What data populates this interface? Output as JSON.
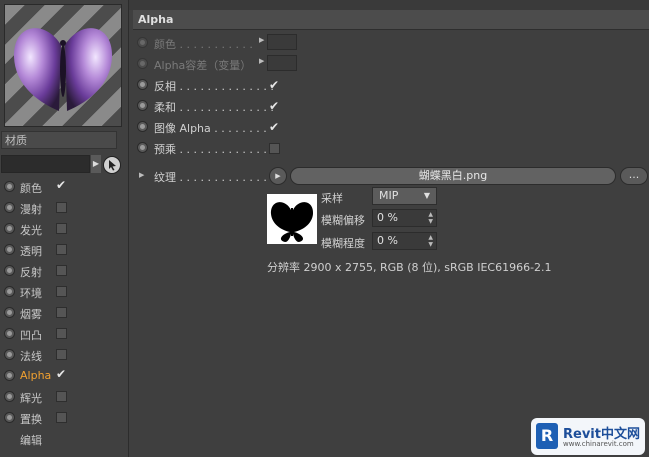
{
  "left_panel": {
    "material_label": "材质",
    "channels": [
      {
        "label": "颜色",
        "checked": true,
        "active": false
      },
      {
        "label": "漫射",
        "checked": false,
        "active": false
      },
      {
        "label": "发光",
        "checked": false,
        "active": false
      },
      {
        "label": "透明",
        "checked": false,
        "active": false
      },
      {
        "label": "反射",
        "checked": false,
        "active": false
      },
      {
        "label": "环境",
        "checked": false,
        "active": false
      },
      {
        "label": "烟雾",
        "checked": false,
        "active": false
      },
      {
        "label": "凹凸",
        "checked": false,
        "active": false
      },
      {
        "label": "法线",
        "checked": false,
        "active": false
      },
      {
        "label": "Alpha",
        "checked": true,
        "active": true
      },
      {
        "label": "辉光",
        "checked": false,
        "active": false
      },
      {
        "label": "置换",
        "checked": false,
        "active": false
      },
      {
        "label": "编辑",
        "checked": null,
        "active": false
      }
    ]
  },
  "alpha_panel": {
    "title": "Alpha",
    "color_label": "颜色 . . . . . . . . . . .",
    "tolerance_label": "Alpha容差（变量）",
    "invert_label": "反相 . . . . . . . . . . . . . .",
    "soft_label": "柔和 . . . . . . . . . . . . . .",
    "image_alpha_label": "图像 Alpha . . . . . . . .",
    "premult_label": "预乘 . . . . . . . . . . . . . .",
    "invert_checked": true,
    "soft_checked": true,
    "image_alpha_checked": true,
    "premult_checked": false,
    "texture_label": "纹理 . . . . . . . . . . . . . . .",
    "texture_file": "蝴蝶黑白.png",
    "more_button": "...",
    "sampling_label": "采样",
    "sampling_value": "MIP",
    "blur_offset_label": "模糊偏移",
    "blur_offset_value": "0 %",
    "blur_degree_label": "模糊程度",
    "blur_degree_value": "0 %",
    "resolution_text": "分辨率 2900 x 2755, RGB (8 位), sRGB IEC61966-2.1"
  },
  "watermark": {
    "brand": "Revit中文网",
    "url": "www.chinarevit.com"
  },
  "colors": {
    "panel_bg": "#3f3f3f",
    "active_channel": "#f0a030",
    "header_bg": "#4c4c4c"
  }
}
